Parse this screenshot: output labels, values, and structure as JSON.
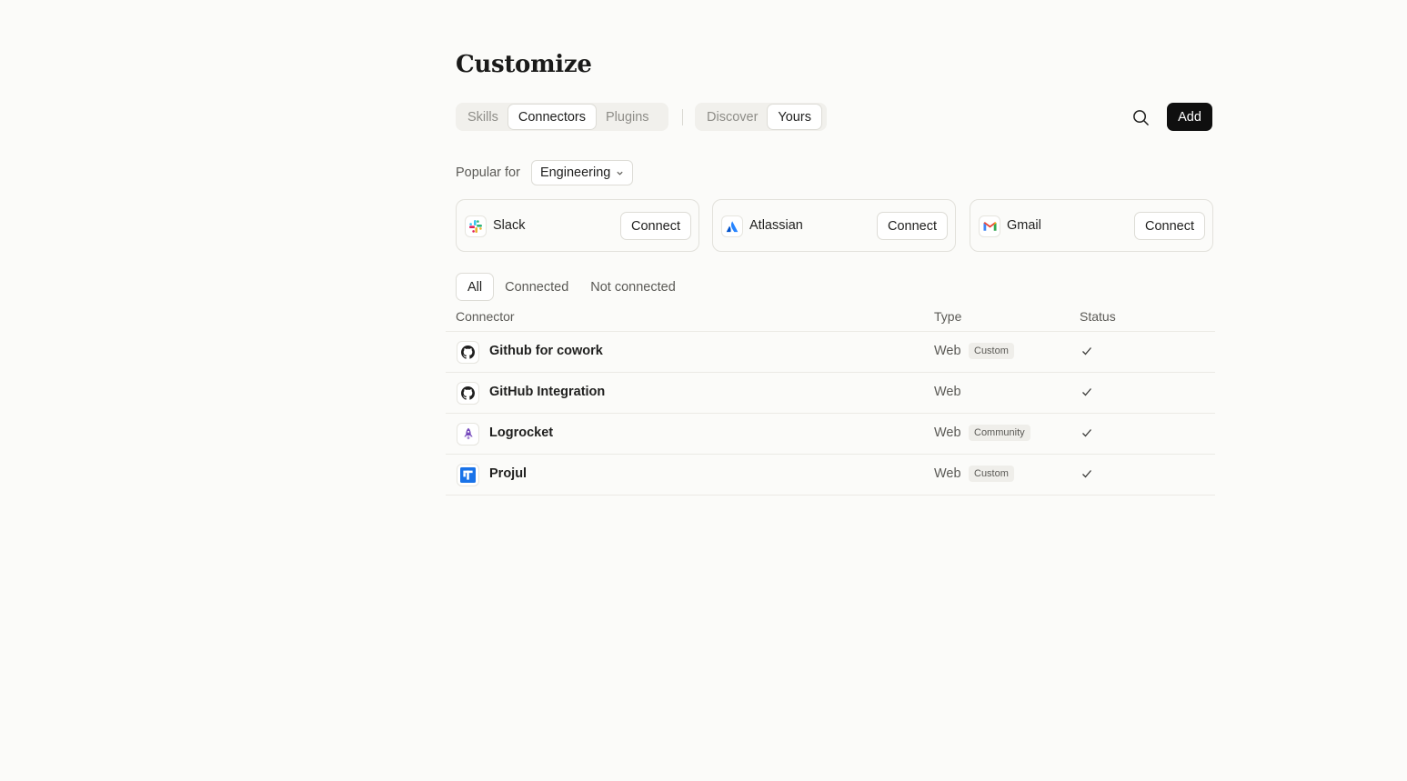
{
  "page": {
    "title": "Customize"
  },
  "main_tabs": [
    {
      "label": "Skills",
      "active": false
    },
    {
      "label": "Connectors",
      "active": true
    },
    {
      "label": "Plugins",
      "active": false
    }
  ],
  "scope_tabs": [
    {
      "label": "Discover",
      "active": false
    },
    {
      "label": "Yours",
      "active": true
    }
  ],
  "toolbar": {
    "search_icon": "search-icon",
    "add_label": "Add"
  },
  "popular": {
    "label": "Popular for",
    "selected": "Engineering",
    "cards": [
      {
        "name": "Slack",
        "icon": "slack-icon",
        "action": "Connect"
      },
      {
        "name": "Atlassian",
        "icon": "atlassian-icon",
        "action": "Connect"
      },
      {
        "name": "Gmail",
        "icon": "gmail-icon",
        "action": "Connect"
      }
    ]
  },
  "filters": [
    {
      "label": "All",
      "active": true
    },
    {
      "label": "Connected",
      "active": false
    },
    {
      "label": "Not connected",
      "active": false
    }
  ],
  "table": {
    "headers": {
      "connector": "Connector",
      "type": "Type",
      "status": "Status"
    },
    "rows": [
      {
        "name": "Github for cowork",
        "icon": "github-icon",
        "type": "Web",
        "badge": "Custom",
        "status": "connected"
      },
      {
        "name": "GitHub Integration",
        "icon": "github-icon",
        "type": "Web",
        "badge": "",
        "status": "connected"
      },
      {
        "name": "Logrocket",
        "icon": "logrocket-icon",
        "type": "Web",
        "badge": "Community",
        "status": "connected"
      },
      {
        "name": "Projul",
        "icon": "projul-icon",
        "type": "Web",
        "badge": "Custom",
        "status": "connected"
      }
    ]
  },
  "colors": {
    "accent": "#0f0f0f",
    "background": "#fbfbf9",
    "border": "#dddcd6",
    "muted_text": "#5b5a56"
  }
}
